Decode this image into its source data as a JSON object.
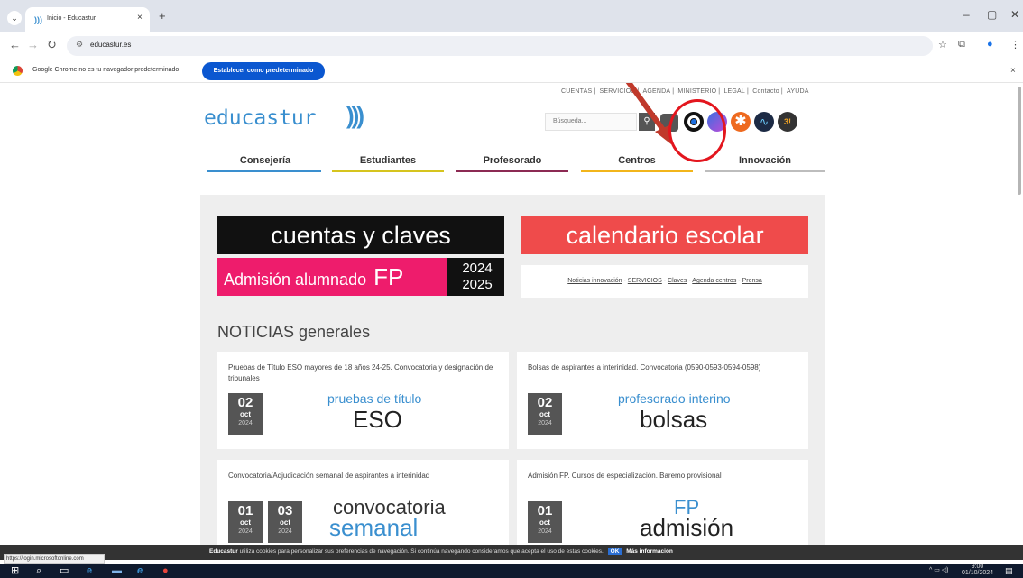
{
  "browser": {
    "tab_title": "Inicio - Educastur",
    "tab_favicon": "educastur-favicon",
    "url": "educastur.es",
    "new_tab": "+",
    "close_tab": "×",
    "min": "–",
    "max": "▢",
    "close": "✕"
  },
  "infobar": {
    "message": "Google Chrome no es tu navegador predeterminado",
    "button": "Establecer como predeterminado",
    "close": "×"
  },
  "header": {
    "toplinks": [
      "CUENTAS",
      "SERVICIOS",
      "AGENDA",
      "MINISTERIO",
      "LEGAL",
      "Contacto",
      "AYUDA"
    ],
    "logo": "educastur",
    "logo_waves": ")))",
    "search_placeholder": "Búsqueda...",
    "apps": [
      {
        "name": "app-office-icon",
        "color": "#555555"
      },
      {
        "name": "app-teams-target-icon",
        "color": "#111111"
      },
      {
        "name": "app-aulas-icon",
        "color": "#7b4cdb"
      },
      {
        "name": "app-star-icon",
        "color": "#ee6a1f"
      },
      {
        "name": "app-wave-icon",
        "color": "#1c2a44"
      },
      {
        "name": "app-blog-icon",
        "color": "#333333"
      }
    ]
  },
  "nav": [
    {
      "label": "Consejería",
      "color": "#3a8fcf"
    },
    {
      "label": "Estudiantes",
      "color": "#d6c41e"
    },
    {
      "label": "Profesorado",
      "color": "#8c2a53"
    },
    {
      "label": "Centros",
      "color": "#f2b51b"
    },
    {
      "label": "Innovación",
      "color": "#bdbdbd"
    }
  ],
  "banners": {
    "cuentas": "cuentas y claves",
    "calendario": "calendario escolar",
    "admision": "Admisión alumnado",
    "admision_fp": "FP",
    "admision_year1": "2024",
    "admision_year2": "2025"
  },
  "quicklinks": {
    "l1": "Noticias innovación",
    "l2": "SERVICIOS",
    "l3": "Claves",
    "l4": "Agenda centros",
    "l5": "Prensa",
    "sep": " - "
  },
  "news_title": "NOTICIAS generales",
  "cards": [
    {
      "title": "Pruebas de Título ESO mayores de 18 años 24-25. Convocatoria y designación de tribunales",
      "day": "02",
      "month": "oct",
      "year": "2024",
      "small": "pruebas de título",
      "big": "ESO"
    },
    {
      "title": "Bolsas de aspirantes a interinidad. Convocatoria (0590-0593-0594-0598)",
      "day": "02",
      "month": "oct",
      "year": "2024",
      "small": "profesorado interino",
      "big": "bolsas"
    },
    {
      "title": "Convocatoria/Adjudicación semanal de aspirantes a interinidad",
      "day": "01",
      "month": "oct",
      "year": "2024",
      "day2": "03",
      "month2": "oct",
      "year2": "2024",
      "small": "convocatoria",
      "big": "semanal"
    },
    {
      "title": "Admisión FP. Cursos de especialización. Baremo provisional",
      "day": "01",
      "month": "oct",
      "year": "2024",
      "small": "FP",
      "big": "admisión"
    }
  ],
  "cookie": {
    "brand": "Educastur",
    "text": "utiliza cookies para personalizar sus preferencias de navegación. Si continúa navegando consideramos que acepta el uso de estas cookies.",
    "ok": "OK",
    "more": "Más información"
  },
  "status_url": "https://login.microsoftonline.com",
  "taskbar": {
    "time": "9:00",
    "date": "01/10/2024"
  }
}
